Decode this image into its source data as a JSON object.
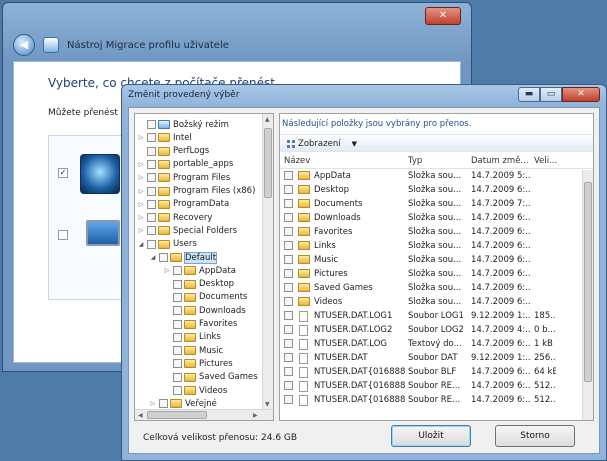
{
  "back_window": {
    "title": "Nástroj Migrace profilu uživatele",
    "heading": "Vyberte, co chcete z počítače přenést",
    "subtext": "Můžete přenést soi",
    "close": "✕",
    "back": "◀"
  },
  "dialog": {
    "title": "Změnit provedený výběr",
    "controls": {
      "minimize": "▬",
      "maximize": "▭",
      "close": "✕"
    },
    "info": "Následující položky jsou vybrány pro přenos.",
    "toolbar": {
      "views_label": "Zobrazení"
    },
    "tree": [
      {
        "label": "Božský režim",
        "level": 1,
        "expander": "",
        "icon": "special"
      },
      {
        "label": "Intel",
        "level": 1,
        "expander": "▷",
        "icon": "folder"
      },
      {
        "label": "PerfLogs",
        "level": 1,
        "expander": "",
        "icon": "folder"
      },
      {
        "label": "portable_apps",
        "level": 1,
        "expander": "▷",
        "icon": "folder"
      },
      {
        "label": "Program Files",
        "level": 1,
        "expander": "▷",
        "icon": "folder"
      },
      {
        "label": "Program Files (x86)",
        "level": 1,
        "expander": "▷",
        "icon": "folder"
      },
      {
        "label": "ProgramData",
        "level": 1,
        "expander": "▷",
        "icon": "folder"
      },
      {
        "label": "Recovery",
        "level": 1,
        "expander": "▷",
        "icon": "folder"
      },
      {
        "label": "Special Folders",
        "level": 1,
        "expander": "▷",
        "icon": "folder"
      },
      {
        "label": "Users",
        "level": 1,
        "expander": "◢",
        "icon": "folder"
      },
      {
        "label": "Default",
        "level": 2,
        "expander": "◢",
        "icon": "folder",
        "selected": true
      },
      {
        "label": "AppData",
        "level": 3,
        "expander": "▷",
        "icon": "folder"
      },
      {
        "label": "Desktop",
        "level": 3,
        "expander": "",
        "icon": "folder"
      },
      {
        "label": "Documents",
        "level": 3,
        "expander": "",
        "icon": "folder"
      },
      {
        "label": "Downloads",
        "level": 3,
        "expander": "",
        "icon": "folder"
      },
      {
        "label": "Favorites",
        "level": 3,
        "expander": "",
        "icon": "folder"
      },
      {
        "label": "Links",
        "level": 3,
        "expander": "",
        "icon": "folder"
      },
      {
        "label": "Music",
        "level": 3,
        "expander": "",
        "icon": "folder"
      },
      {
        "label": "Pictures",
        "level": 3,
        "expander": "",
        "icon": "folder"
      },
      {
        "label": "Saved Games",
        "level": 3,
        "expander": "",
        "icon": "folder"
      },
      {
        "label": "Videos",
        "level": 3,
        "expander": "",
        "icon": "folder"
      },
      {
        "label": "Veřejné",
        "level": 2,
        "expander": "▷",
        "icon": "folder"
      }
    ],
    "columns": {
      "name": "Název",
      "type": "Typ",
      "date": "Datum změ...",
      "size": "Veli..."
    },
    "files": [
      {
        "name": "AppData",
        "type": "Složka sou...",
        "date": "14.7.2009 5:...",
        "size": "",
        "kind": "folder"
      },
      {
        "name": "Desktop",
        "type": "Složka sou...",
        "date": "14.7.2009 6:...",
        "size": "",
        "kind": "folder"
      },
      {
        "name": "Documents",
        "type": "Složka sou...",
        "date": "14.7.2009 7:...",
        "size": "",
        "kind": "folder"
      },
      {
        "name": "Downloads",
        "type": "Složka sou...",
        "date": "14.7.2009 6:...",
        "size": "",
        "kind": "folder"
      },
      {
        "name": "Favorites",
        "type": "Složka sou...",
        "date": "14.7.2009 6:...",
        "size": "",
        "kind": "folder"
      },
      {
        "name": "Links",
        "type": "Složka sou...",
        "date": "14.7.2009 6:...",
        "size": "",
        "kind": "folder"
      },
      {
        "name": "Music",
        "type": "Složka sou...",
        "date": "14.7.2009 6:...",
        "size": "",
        "kind": "folder"
      },
      {
        "name": "Pictures",
        "type": "Složka sou...",
        "date": "14.7.2009 6:...",
        "size": "",
        "kind": "folder"
      },
      {
        "name": "Saved Games",
        "type": "Složka sou...",
        "date": "14.7.2009 6:...",
        "size": "",
        "kind": "folder"
      },
      {
        "name": "Videos",
        "type": "Složka sou...",
        "date": "14.7.2009 6:...",
        "size": "",
        "kind": "folder"
      },
      {
        "name": "NTUSER.DAT.LOG1",
        "type": "Soubor LOG1",
        "date": "9.12.2009 1:...",
        "size": "185...",
        "kind": "file"
      },
      {
        "name": "NTUSER.DAT.LOG2",
        "type": "Soubor LOG2",
        "date": "14.7.2009 4:...",
        "size": "0 b...",
        "kind": "file"
      },
      {
        "name": "NTUSER.DAT.LOG",
        "type": "Textový do...",
        "date": "14.7.2009 6:...",
        "size": "1 kB",
        "kind": "file"
      },
      {
        "name": "NTUSER.DAT",
        "type": "Soubor DAT",
        "date": "9.12.2009 1:...",
        "size": "256...",
        "kind": "file"
      },
      {
        "name": "NTUSER.DAT{016888b...",
        "type": "Soubor BLF",
        "date": "14.7.2009 6:...",
        "size": "64 kB",
        "kind": "file"
      },
      {
        "name": "NTUSER.DAT{016888b...",
        "type": "Soubor RE...",
        "date": "14.7.2009 6:...",
        "size": "512...",
        "kind": "file"
      },
      {
        "name": "NTUSER.DAT{016888b...",
        "type": "Soubor RE...",
        "date": "14.7.2009 6:...",
        "size": "512...",
        "kind": "file"
      }
    ],
    "total_label": "Celková velikost přenosu: 24.6 GB",
    "save_label": "Uložit",
    "cancel_label": "Storno"
  }
}
